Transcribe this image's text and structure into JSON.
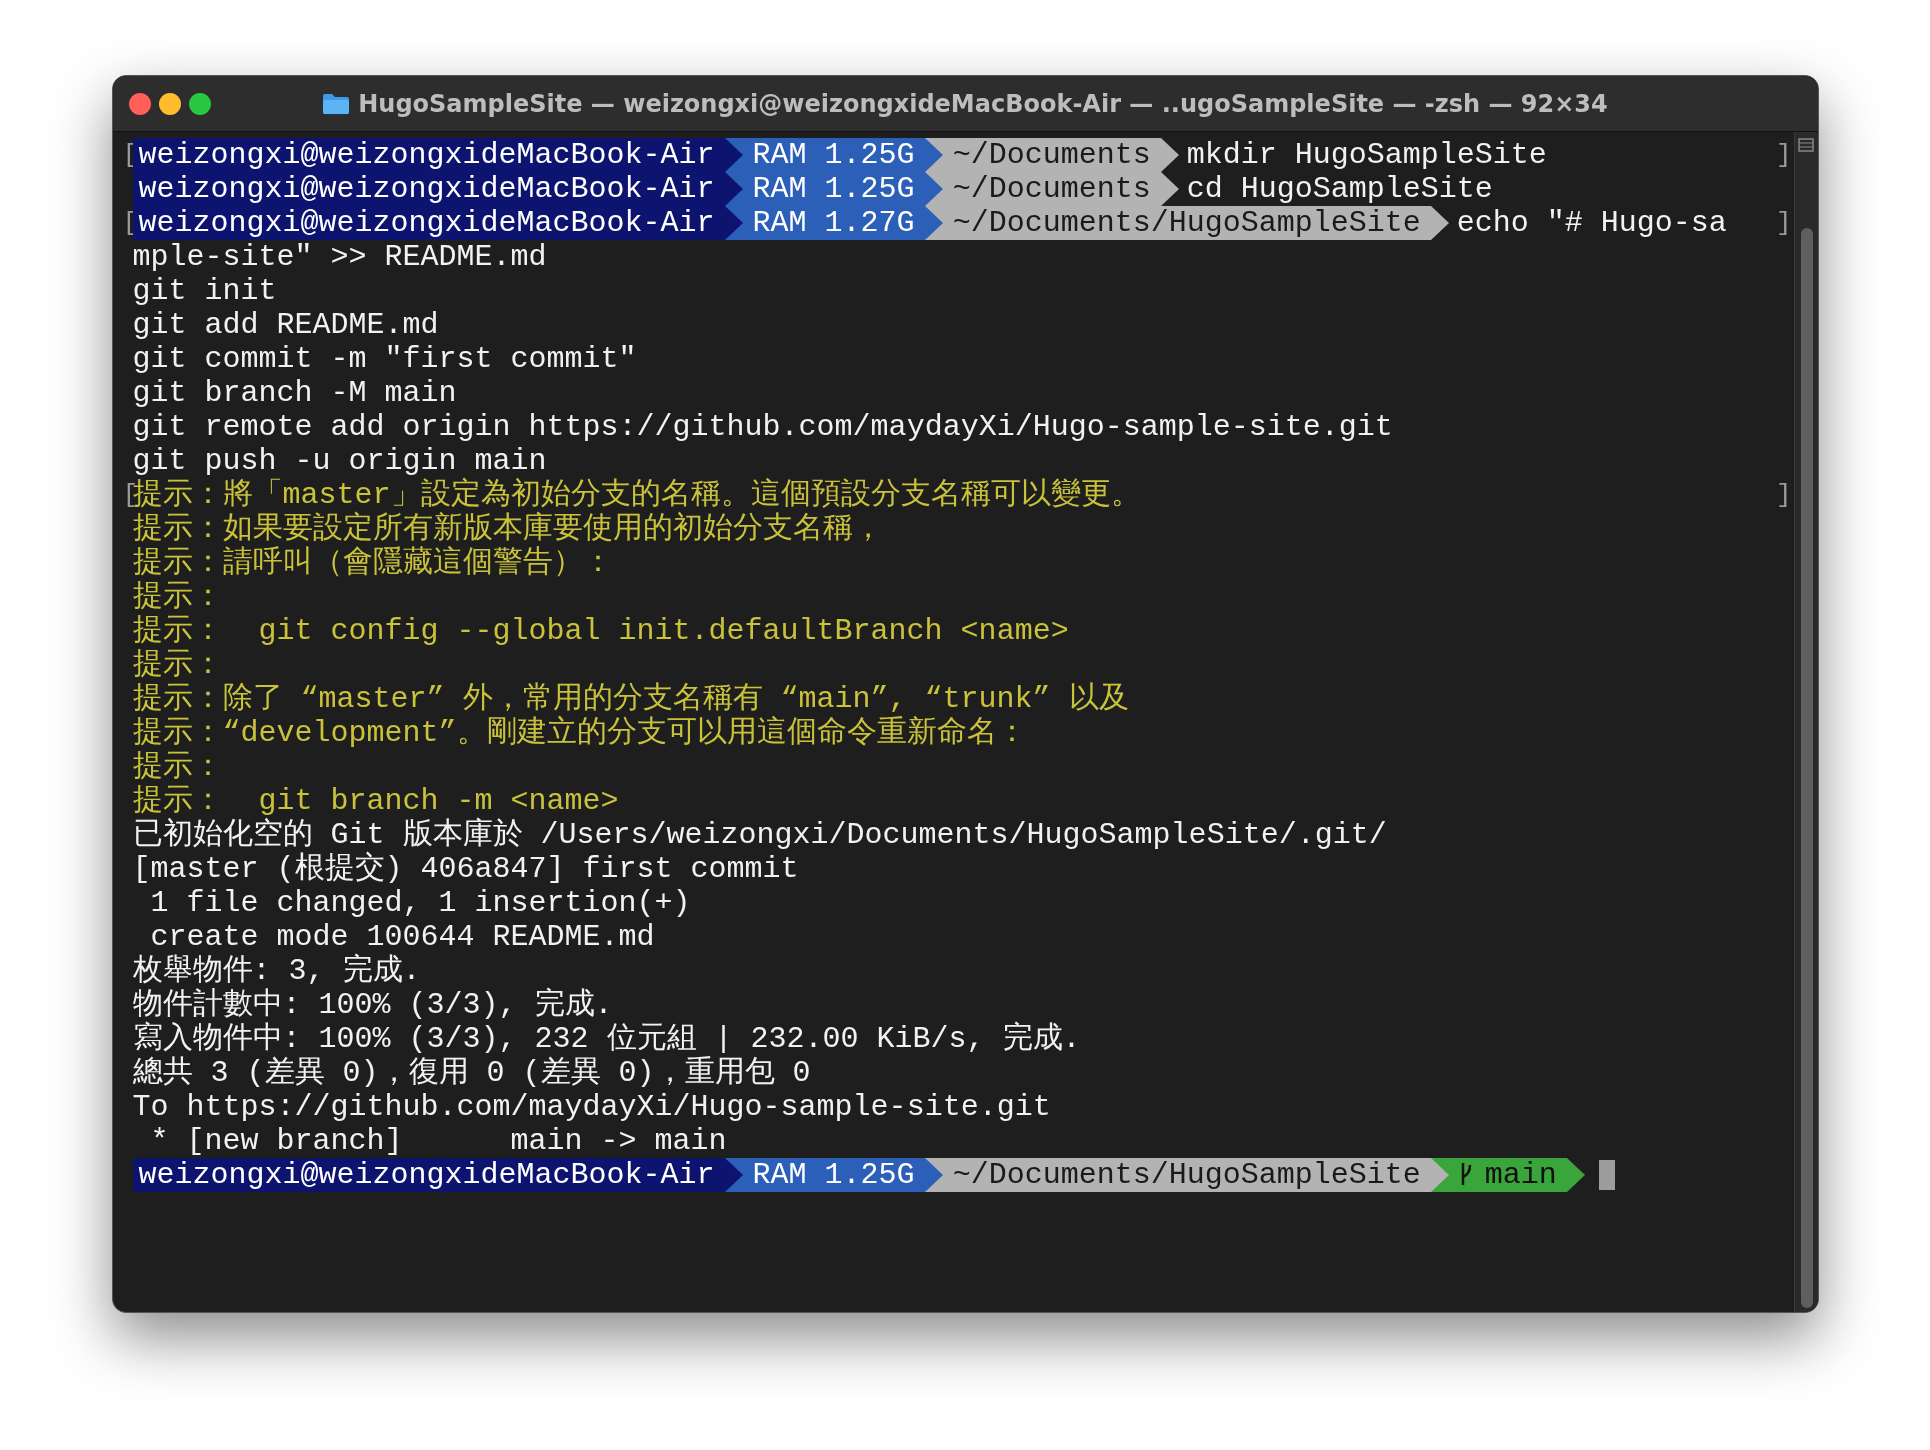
{
  "window": {
    "title": "HugoSampleSite — weizongxi@weizongxideMacBook-Air — ..ugoSampleSite — -zsh — 92×34"
  },
  "lines": [
    {
      "kind": "prompt",
      "marked": true,
      "mark_left": "[",
      "mark_right": "]",
      "user": "weizongxi@weizongxideMacBook-Air",
      "ram": "RAM 1.25G",
      "path": "~/Documents",
      "command": "mkdir HugoSampleSite"
    },
    {
      "kind": "prompt",
      "marked": false,
      "user": "weizongxi@weizongxideMacBook-Air",
      "ram": "RAM 1.25G",
      "path": "~/Documents",
      "command": "cd HugoSampleSite"
    },
    {
      "kind": "prompt",
      "marked": true,
      "mark_left": "[",
      "mark_right": "]",
      "user": "weizongxi@weizongxideMacBook-Air",
      "ram": "RAM 1.27G",
      "path": "~/Documents/HugoSampleSite",
      "command": "echo \"# Hugo-sa"
    },
    {
      "kind": "output",
      "marked": false,
      "text": "mple-site\" >> README.md"
    },
    {
      "kind": "output",
      "marked": false,
      "text": "git init"
    },
    {
      "kind": "output",
      "marked": false,
      "text": "git add README.md"
    },
    {
      "kind": "output",
      "marked": false,
      "text": "git commit -m \"first commit\""
    },
    {
      "kind": "output",
      "marked": false,
      "text": "git branch -M main"
    },
    {
      "kind": "output",
      "marked": false,
      "text": "git remote add origin https://github.com/maydayXi/Hugo-sample-site.git"
    },
    {
      "kind": "output",
      "marked": false,
      "text": "git push -u origin main"
    },
    {
      "kind": "hint",
      "marked": true,
      "mark_left": "[",
      "mark_right": "]",
      "text": "提示：將「master」設定為初始分支的名稱。這個預設分支名稱可以變更。"
    },
    {
      "kind": "hint",
      "marked": false,
      "text": "提示：如果要設定所有新版本庫要使用的初始分支名稱，"
    },
    {
      "kind": "hint",
      "marked": false,
      "text": "提示：請呼叫（會隱藏這個警告）："
    },
    {
      "kind": "hint",
      "marked": false,
      "text": "提示："
    },
    {
      "kind": "hint",
      "marked": false,
      "text": "提示：  git config --global init.defaultBranch <name>"
    },
    {
      "kind": "hint",
      "marked": false,
      "text": "提示："
    },
    {
      "kind": "hint",
      "marked": false,
      "text": "提示：除了 “master” 外，常用的分支名稱有 “main”, “trunk” 以及"
    },
    {
      "kind": "hint",
      "marked": false,
      "text": "提示：“development”。剛建立的分支可以用這個命令重新命名："
    },
    {
      "kind": "hint",
      "marked": false,
      "text": "提示："
    },
    {
      "kind": "hint",
      "marked": false,
      "text": "提示：  git branch -m <name>"
    },
    {
      "kind": "output",
      "marked": false,
      "text": "已初始化空的 Git 版本庫於 /Users/weizongxi/Documents/HugoSampleSite/.git/"
    },
    {
      "kind": "output",
      "marked": false,
      "text": "[master (根提交) 406a847] first commit"
    },
    {
      "kind": "output",
      "marked": false,
      "text": " 1 file changed, 1 insertion(+)"
    },
    {
      "kind": "output",
      "marked": false,
      "text": " create mode 100644 README.md"
    },
    {
      "kind": "output",
      "marked": false,
      "text": "枚舉物件: 3, 完成."
    },
    {
      "kind": "output",
      "marked": false,
      "text": "物件計數中: 100% (3/3), 完成."
    },
    {
      "kind": "output",
      "marked": false,
      "text": "寫入物件中: 100% (3/3), 232 位元組 | 232.00 KiB/s, 完成."
    },
    {
      "kind": "output",
      "marked": false,
      "text": "總共 3 (差異 0)，復用 0 (差異 0)，重用包 0"
    },
    {
      "kind": "output",
      "marked": false,
      "text": "To https://github.com/maydayXi/Hugo-sample-site.git"
    },
    {
      "kind": "output",
      "marked": false,
      "text": " * [new branch]      main -> main"
    },
    {
      "kind": "prompt",
      "marked": false,
      "user": "weizongxi@weizongxideMacBook-Air",
      "ram": "RAM 1.25G",
      "path": "~/Documents/HugoSampleSite",
      "branch": "main",
      "cursor": true
    }
  ]
}
